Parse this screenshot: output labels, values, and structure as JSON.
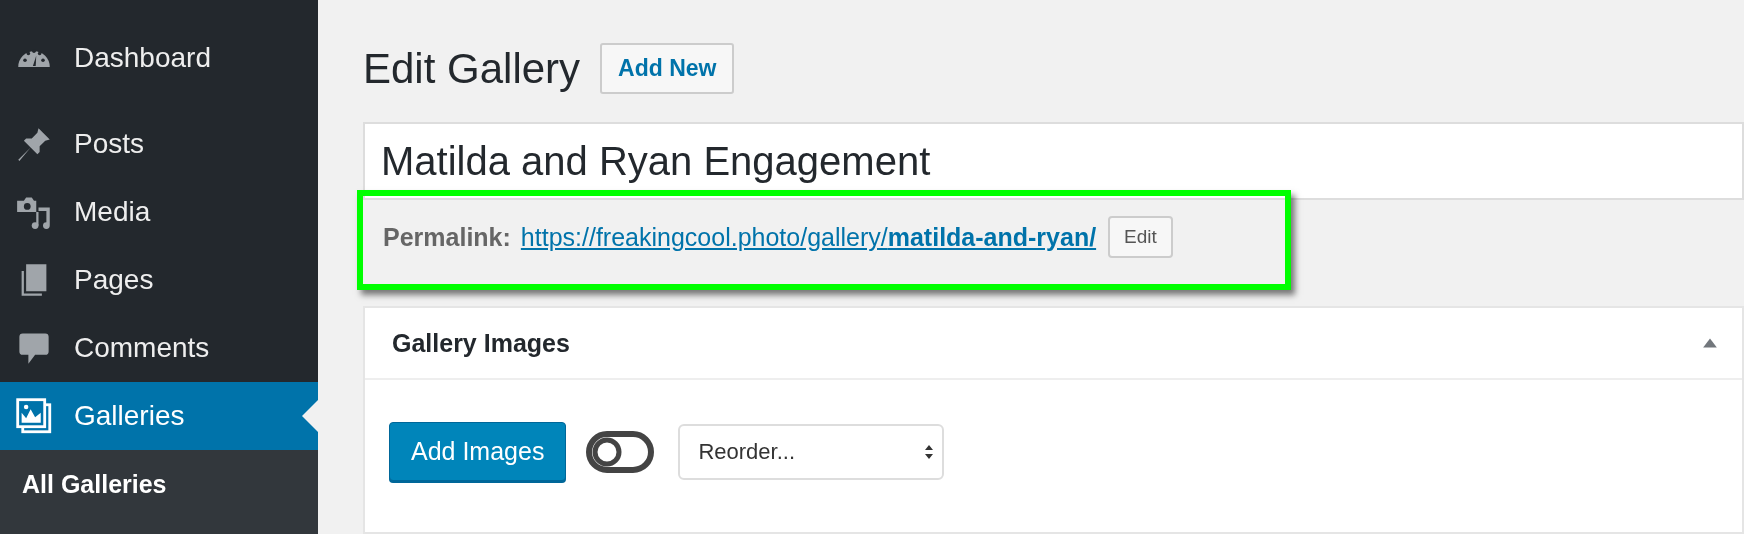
{
  "sidebar": {
    "items": [
      {
        "label": "Dashboard",
        "kind": "dashboard",
        "selected": false
      },
      {
        "label": "Posts",
        "kind": "pin",
        "selected": false
      },
      {
        "label": "Media",
        "kind": "media",
        "selected": false
      },
      {
        "label": "Pages",
        "kind": "pages",
        "selected": false
      },
      {
        "label": "Comments",
        "kind": "comment",
        "selected": false
      },
      {
        "label": "Galleries",
        "kind": "gallery",
        "selected": true
      }
    ],
    "submenu": [
      {
        "label": "All Galleries",
        "selected": true
      }
    ]
  },
  "header": {
    "title": "Edit Gallery",
    "add_button": "Add New"
  },
  "title_field": {
    "value": "Matilda and Ryan Engagement"
  },
  "permalink": {
    "label": "Permalink:",
    "url": "https://freakingcool.photo/gallery/**matilda-and-ryan/**",
    "edit_button": "Edit"
  },
  "panel": {
    "title": "Gallery Images",
    "expanded": true,
    "add_button": "Add Images",
    "toggle": {
      "on": false
    },
    "reorder_select": {
      "value": "Reorder..."
    }
  }
}
